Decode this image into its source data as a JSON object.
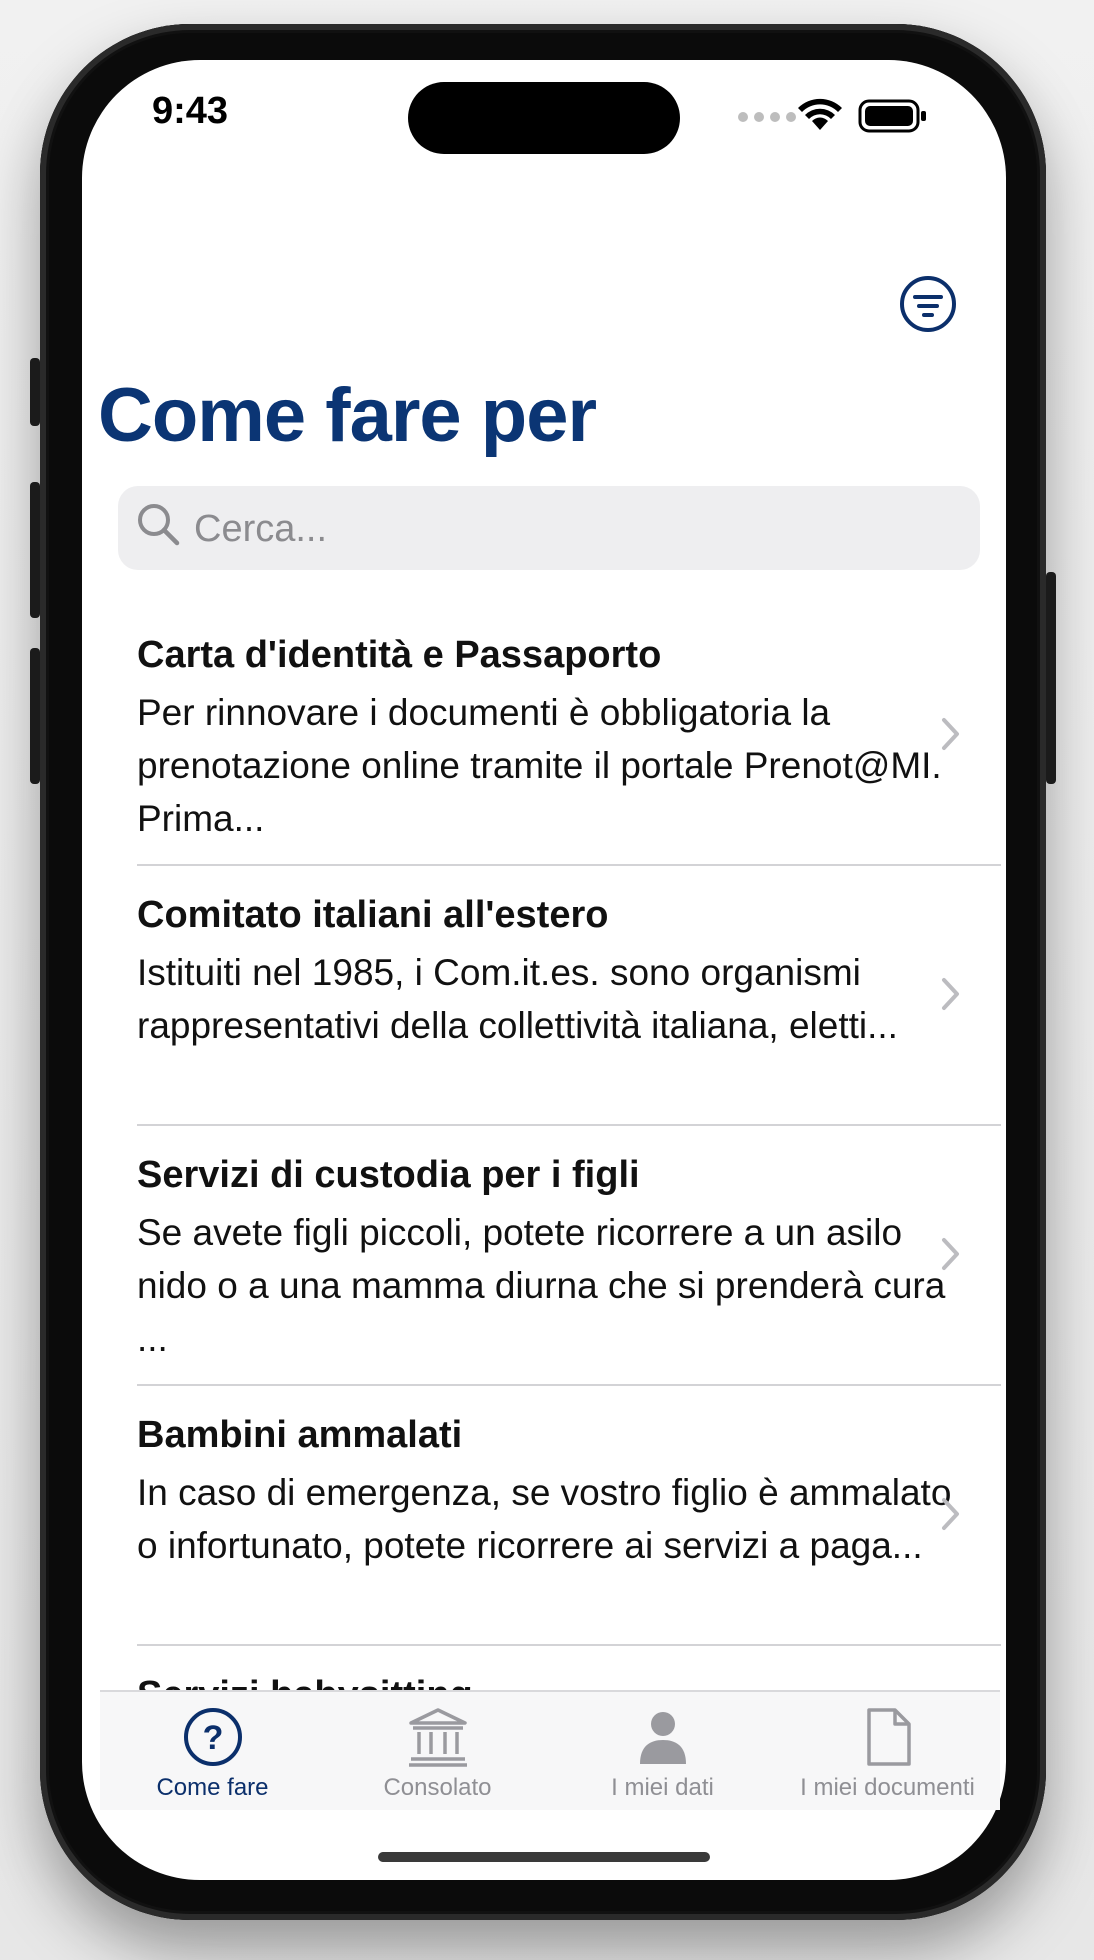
{
  "status_bar": {
    "time": "9:43",
    "icons": [
      "signal-dots-icon",
      "wifi-icon",
      "battery-icon"
    ]
  },
  "header": {
    "filter_icon": "filter-lines-icon",
    "title": "Come fare per"
  },
  "search": {
    "placeholder": "Cerca...",
    "value": "",
    "icon": "search-icon"
  },
  "list": {
    "items": [
      {
        "title": "Carta d'identità e Passaporto",
        "description": "Per rinnovare i documenti è obbligatoria la prenotazione online tramite il portale Prenot@MI. Prima..."
      },
      {
        "title": "Comitato italiani all'estero",
        "description": "Istituiti nel 1985, i Com.it.es. sono organismi rappresentativi della collettività italiana, eletti..."
      },
      {
        "title": "Servizi di custodia per i figli",
        "description": "Se avete figli piccoli, potete ricorrere a un asilo nido o a una mamma diurna che si prenderà cura ..."
      },
      {
        "title": "Bambini ammalati",
        "description": "In caso di emergenza, se vostro figlio è ammalato o infortunato, potete ricorrere ai servizi a paga..."
      },
      {
        "title": "Servizi babysitting",
        "description": ""
      }
    ]
  },
  "tab_bar": {
    "tabs": [
      {
        "label": "Come fare",
        "icon": "question-circle-icon",
        "active": true
      },
      {
        "label": "Consolato",
        "icon": "building-columns-icon",
        "active": false
      },
      {
        "label": "I miei dati",
        "icon": "person-icon",
        "active": false
      },
      {
        "label": "I miei documenti",
        "icon": "document-icon",
        "active": false
      }
    ]
  },
  "colors": {
    "brand": "#0b3574",
    "accent": "#0b2f6b",
    "inactive": "#8f8f94"
  }
}
